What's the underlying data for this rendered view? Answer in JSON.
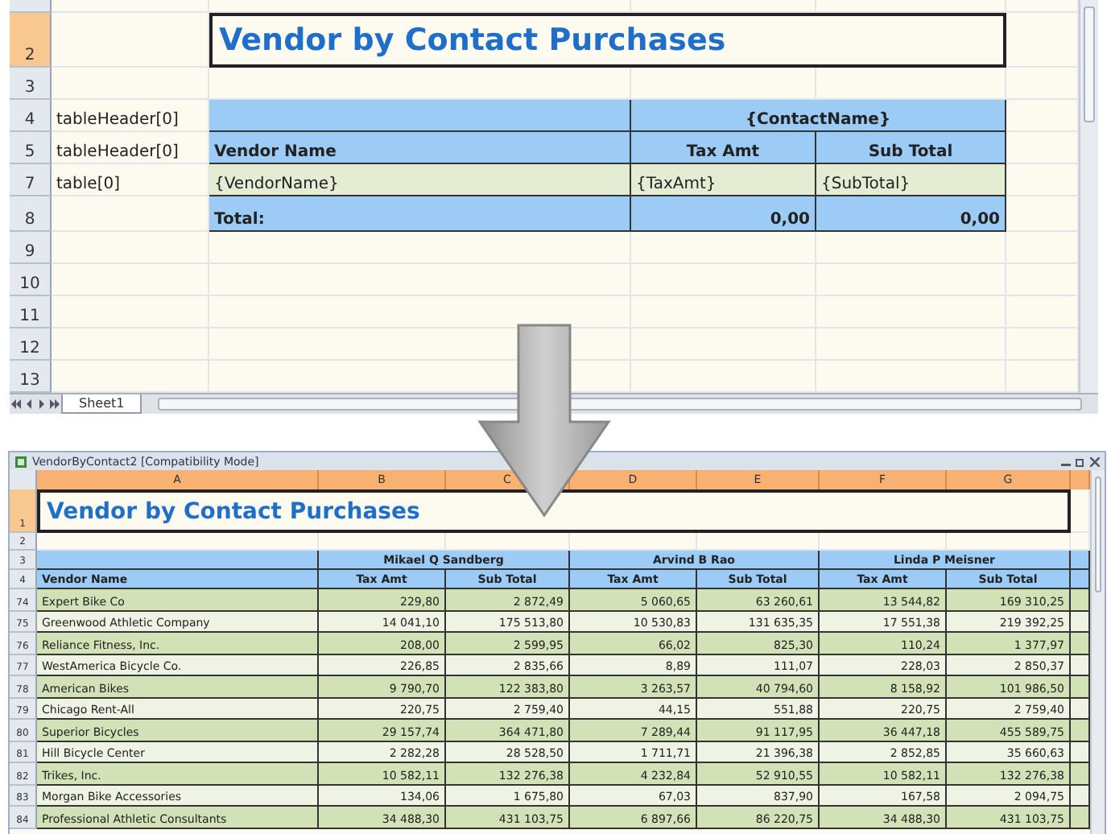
{
  "template_sheet": {
    "rows": [
      {
        "number": "2",
        "selected": true,
        "kind": "title",
        "title": "Vendor by Contact Purchases"
      },
      {
        "number": "3",
        "selected": false,
        "kind": "blank"
      },
      {
        "number": "4",
        "selected": false,
        "kind": "group_header",
        "label": "tableHeader[0]",
        "group": "{ContactName}"
      },
      {
        "number": "5",
        "selected": false,
        "kind": "column_header",
        "label": "tableHeader[0]",
        "cells": [
          "Vendor Name",
          "Tax Amt",
          "Sub Total"
        ]
      },
      {
        "number": "7",
        "selected": false,
        "kind": "data",
        "label": "table[0]",
        "cells": [
          "{VendorName}",
          "{TaxAmt}",
          "{SubTotal}"
        ]
      },
      {
        "number": "8",
        "selected": false,
        "kind": "total",
        "cells": [
          "Total:",
          "0,00",
          "0,00"
        ]
      },
      {
        "number": "9",
        "selected": false,
        "kind": "blank"
      },
      {
        "number": "10",
        "selected": false,
        "kind": "blank"
      },
      {
        "number": "11",
        "selected": false,
        "kind": "blank"
      },
      {
        "number": "12",
        "selected": false,
        "kind": "blank"
      },
      {
        "number": "13",
        "selected": false,
        "kind": "blank"
      }
    ],
    "sheet_tabs": [
      {
        "label": "Sheet1",
        "selected": true
      }
    ]
  },
  "result_window": {
    "title": "VendorByContact2  [Compatibility Mode]",
    "columns": [
      "A",
      "B",
      "C",
      "D",
      "E",
      "F",
      "G"
    ],
    "title_row": {
      "number": "1",
      "selected": true,
      "title": "Vendor by Contact Purchases"
    },
    "blank_row": {
      "number": "2"
    },
    "contact_row": {
      "number": "3",
      "contacts": [
        "Mikael Q Sandberg",
        "Arvind B Rao",
        "Linda P Meisner"
      ]
    },
    "header_row": {
      "number": "4",
      "vendor": "Vendor Name",
      "subheaders": [
        "Tax Amt",
        "Sub Total",
        "Tax Amt",
        "Sub Total",
        "Tax Amt",
        "Sub Total"
      ]
    },
    "rows": [
      {
        "number": "74",
        "vendor": "Expert Bike Co",
        "values": [
          "229,80",
          "2 872,49",
          "5 060,65",
          "63 260,61",
          "13 544,82",
          "169 310,25"
        ]
      },
      {
        "number": "75",
        "vendor": "Greenwood Athletic Company",
        "values": [
          "14 041,10",
          "175 513,80",
          "10 530,83",
          "131 635,35",
          "17 551,38",
          "219 392,25"
        ]
      },
      {
        "number": "76",
        "vendor": "Reliance Fitness, Inc.",
        "values": [
          "208,00",
          "2 599,95",
          "66,02",
          "825,30",
          "110,24",
          "1 377,97"
        ]
      },
      {
        "number": "77",
        "vendor": "WestAmerica Bicycle Co.",
        "values": [
          "226,85",
          "2 835,66",
          "8,89",
          "111,07",
          "228,03",
          "2 850,37"
        ]
      },
      {
        "number": "78",
        "vendor": "American Bikes",
        "values": [
          "9 790,70",
          "122 383,80",
          "3 263,57",
          "40 794,60",
          "8 158,92",
          "101 986,50"
        ]
      },
      {
        "number": "79",
        "vendor": "Chicago Rent-All",
        "values": [
          "220,75",
          "2 759,40",
          "44,15",
          "551,88",
          "220,75",
          "2 759,40"
        ]
      },
      {
        "number": "80",
        "vendor": "Superior Bicycles",
        "values": [
          "29 157,74",
          "364 471,80",
          "7 289,44",
          "91 117,95",
          "36 447,18",
          "455 589,75"
        ]
      },
      {
        "number": "81",
        "vendor": "Hill Bicycle Center",
        "values": [
          "2 282,28",
          "28 528,50",
          "1 711,71",
          "21 396,38",
          "2 852,85",
          "35 660,63"
        ]
      },
      {
        "number": "82",
        "vendor": "Trikes, Inc.",
        "values": [
          "10 582,11",
          "132 276,38",
          "4 232,84",
          "52 910,55",
          "10 582,11",
          "132 276,38"
        ]
      },
      {
        "number": "83",
        "vendor": "Morgan Bike Accessories",
        "values": [
          "134,06",
          "1 675,80",
          "67,03",
          "837,90",
          "167,58",
          "2 094,75"
        ]
      },
      {
        "number": "84",
        "vendor": "Professional Athletic Consultants",
        "values": [
          "34 488,30",
          "431 103,75",
          "6 897,66",
          "86 220,75",
          "34 488,30",
          "431 103,75"
        ]
      }
    ]
  }
}
